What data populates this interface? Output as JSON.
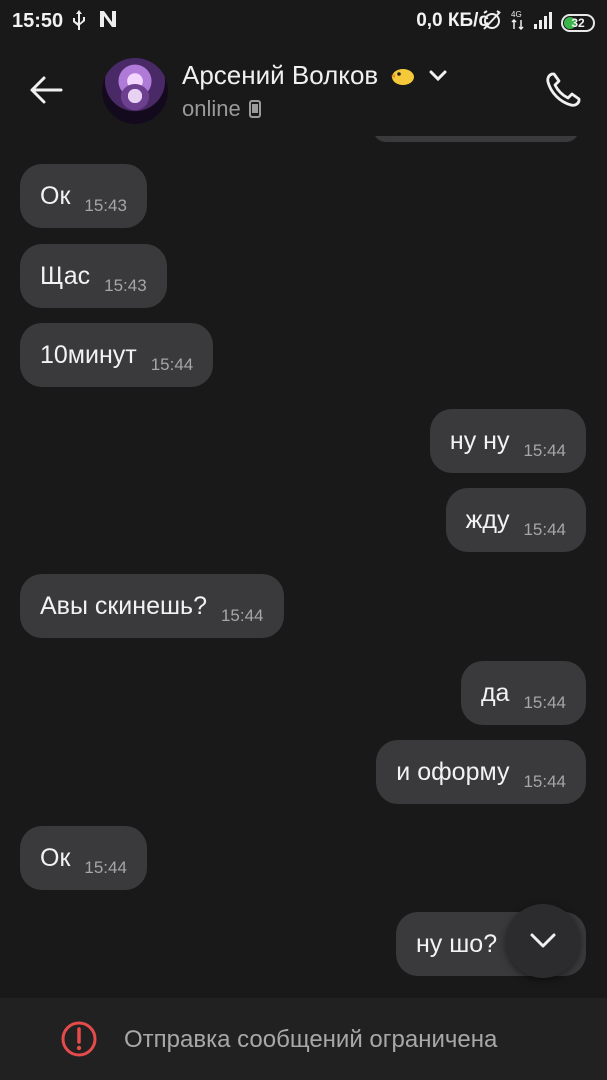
{
  "status_bar": {
    "time": "15:50",
    "network_speed": "0,0 КБ/с",
    "battery": "32",
    "icons_left": [
      "usb-icon",
      "n-notification-icon"
    ],
    "icons_right": [
      "alarm-off-icon",
      "4g-icon",
      "signal-icon",
      "battery-icon"
    ]
  },
  "header": {
    "contact_name": "Арсений Волков",
    "name_emoji": "chick-emoji-icon",
    "status": "online",
    "icons": [
      "back-arrow-icon",
      "chevron-down-icon",
      "phone-icon",
      "device-icon"
    ]
  },
  "messages": [
    {
      "dir": "in",
      "text": "Ок",
      "time": "15:43"
    },
    {
      "dir": "in",
      "text": "Щас",
      "time": "15:43"
    },
    {
      "dir": "in",
      "text": "10минут",
      "time": "15:44"
    },
    {
      "dir": "out",
      "text": "ну ну",
      "time": "15:44"
    },
    {
      "dir": "out",
      "text": "жду",
      "time": "15:44"
    },
    {
      "dir": "in",
      "text": "Авы скинешь?",
      "time": "15:44"
    },
    {
      "dir": "out",
      "text": "да",
      "time": "15:44"
    },
    {
      "dir": "out",
      "text": "и оформу",
      "time": "15:44"
    },
    {
      "dir": "in",
      "text": "Ок",
      "time": "15:44"
    },
    {
      "dir": "out",
      "text": "ну шо?",
      "time": ""
    }
  ],
  "bottom_bar": {
    "restriction_text": "Отправка сообщений ограничена",
    "icon": "warning-circle-icon"
  },
  "colors": {
    "background": "#19191a",
    "bubble": "#3a3a3c",
    "warning": "#e54b4b",
    "battery_fill": "#39b54a"
  }
}
